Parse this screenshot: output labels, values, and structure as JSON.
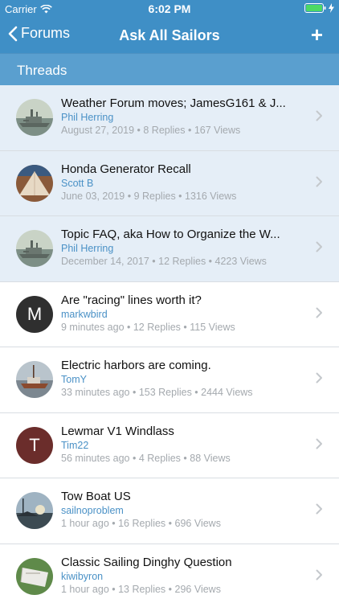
{
  "status": {
    "carrier": "Carrier",
    "time": "6:02 PM"
  },
  "nav": {
    "back_label": "Forums",
    "title": "Ask All Sailors",
    "add_label": "+"
  },
  "section": {
    "label": "Threads"
  },
  "threads": [
    {
      "title": "Weather Forum moves; JamesG161 & J...",
      "author": "Phil Herring",
      "date": "August 27, 2019",
      "replies": "8 Replies",
      "views": "167 Views",
      "sticky": true,
      "avatar": "ship"
    },
    {
      "title": "Honda Generator Recall",
      "author": "Scott B",
      "date": "June 03, 2019",
      "replies": "9 Replies",
      "views": "1316 Views",
      "sticky": true,
      "avatar": "sail"
    },
    {
      "title": "Topic FAQ, aka How to Organize the W...",
      "author": "Phil Herring",
      "date": "December 14, 2017",
      "replies": "12 Replies",
      "views": "4223 Views",
      "sticky": true,
      "avatar": "ship"
    },
    {
      "title": "Are \"racing\" lines worth it?",
      "author": "markwbird",
      "date": "9 minutes ago",
      "replies": "12 Replies",
      "views": "115 Views",
      "sticky": false,
      "avatar": "letter",
      "letter": "M",
      "color": "#2f2f2f"
    },
    {
      "title": "Electric harbors are coming.",
      "author": "TomY",
      "date": "33 minutes ago",
      "replies": "153 Replies",
      "views": "2444 Views",
      "sticky": false,
      "avatar": "boat"
    },
    {
      "title": "Lewmar V1 Windlass",
      "author": "Tim22",
      "date": "56 minutes ago",
      "replies": "4 Replies",
      "views": "88 Views",
      "sticky": false,
      "avatar": "letter",
      "letter": "T",
      "color": "#6b2d2b"
    },
    {
      "title": "Tow Boat US",
      "author": "sailnoproblem",
      "date": "1 hour ago",
      "replies": "16 Replies",
      "views": "696 Views",
      "sticky": false,
      "avatar": "sunset"
    },
    {
      "title": "Classic Sailing Dinghy Question",
      "author": "kiwibyron",
      "date": "1 hour ago",
      "replies": "13 Replies",
      "views": "296 Views",
      "sticky": false,
      "avatar": "dinghy"
    }
  ],
  "colors": {
    "header": "#3f8fc6",
    "section": "#5a9fcf",
    "sticky_row": "#e5eef7",
    "author": "#4a91c6",
    "meta": "#a4a9ae"
  }
}
